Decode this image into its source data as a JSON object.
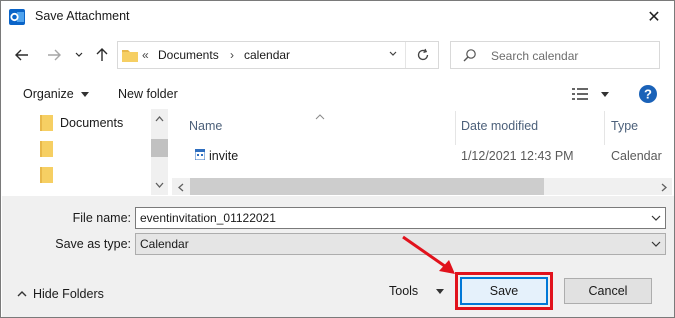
{
  "window": {
    "title": "Save Attachment",
    "app_icon": "outlook-icon",
    "close_glyph": "✕"
  },
  "nav": {
    "back_icon": "back-arrow-icon",
    "forward_icon": "forward-arrow-icon",
    "recent_icon": "chevron-down-icon",
    "up_icon": "up-arrow-icon",
    "breadcrumb_sep": "«",
    "path": [
      "Documents",
      "calendar"
    ],
    "refresh_icon": "refresh-icon",
    "search_placeholder": "Search calendar"
  },
  "commands": {
    "organize": "Organize",
    "new_folder": "New folder"
  },
  "tree": {
    "items": [
      {
        "label": "Documents"
      },
      {
        "label": ""
      },
      {
        "label": ""
      }
    ]
  },
  "files": {
    "columns": {
      "name": "Name",
      "date_modified": "Date modified",
      "type": "Type"
    },
    "rows": [
      {
        "name": "invite",
        "date_modified": "1/12/2021 12:43 PM",
        "type": "Calendar"
      }
    ]
  },
  "form": {
    "file_name_label": "File name:",
    "file_name_value": "eventinvitation_01122021",
    "save_as_type_label": "Save as type:",
    "save_as_type_value": "Calendar"
  },
  "footer": {
    "hide_folders": "Hide Folders",
    "tools": "Tools",
    "save": "Save",
    "cancel": "Cancel"
  },
  "colors": {
    "highlight": "#e1121c",
    "accent": "#0078d7",
    "header_text": "#4c607a"
  }
}
